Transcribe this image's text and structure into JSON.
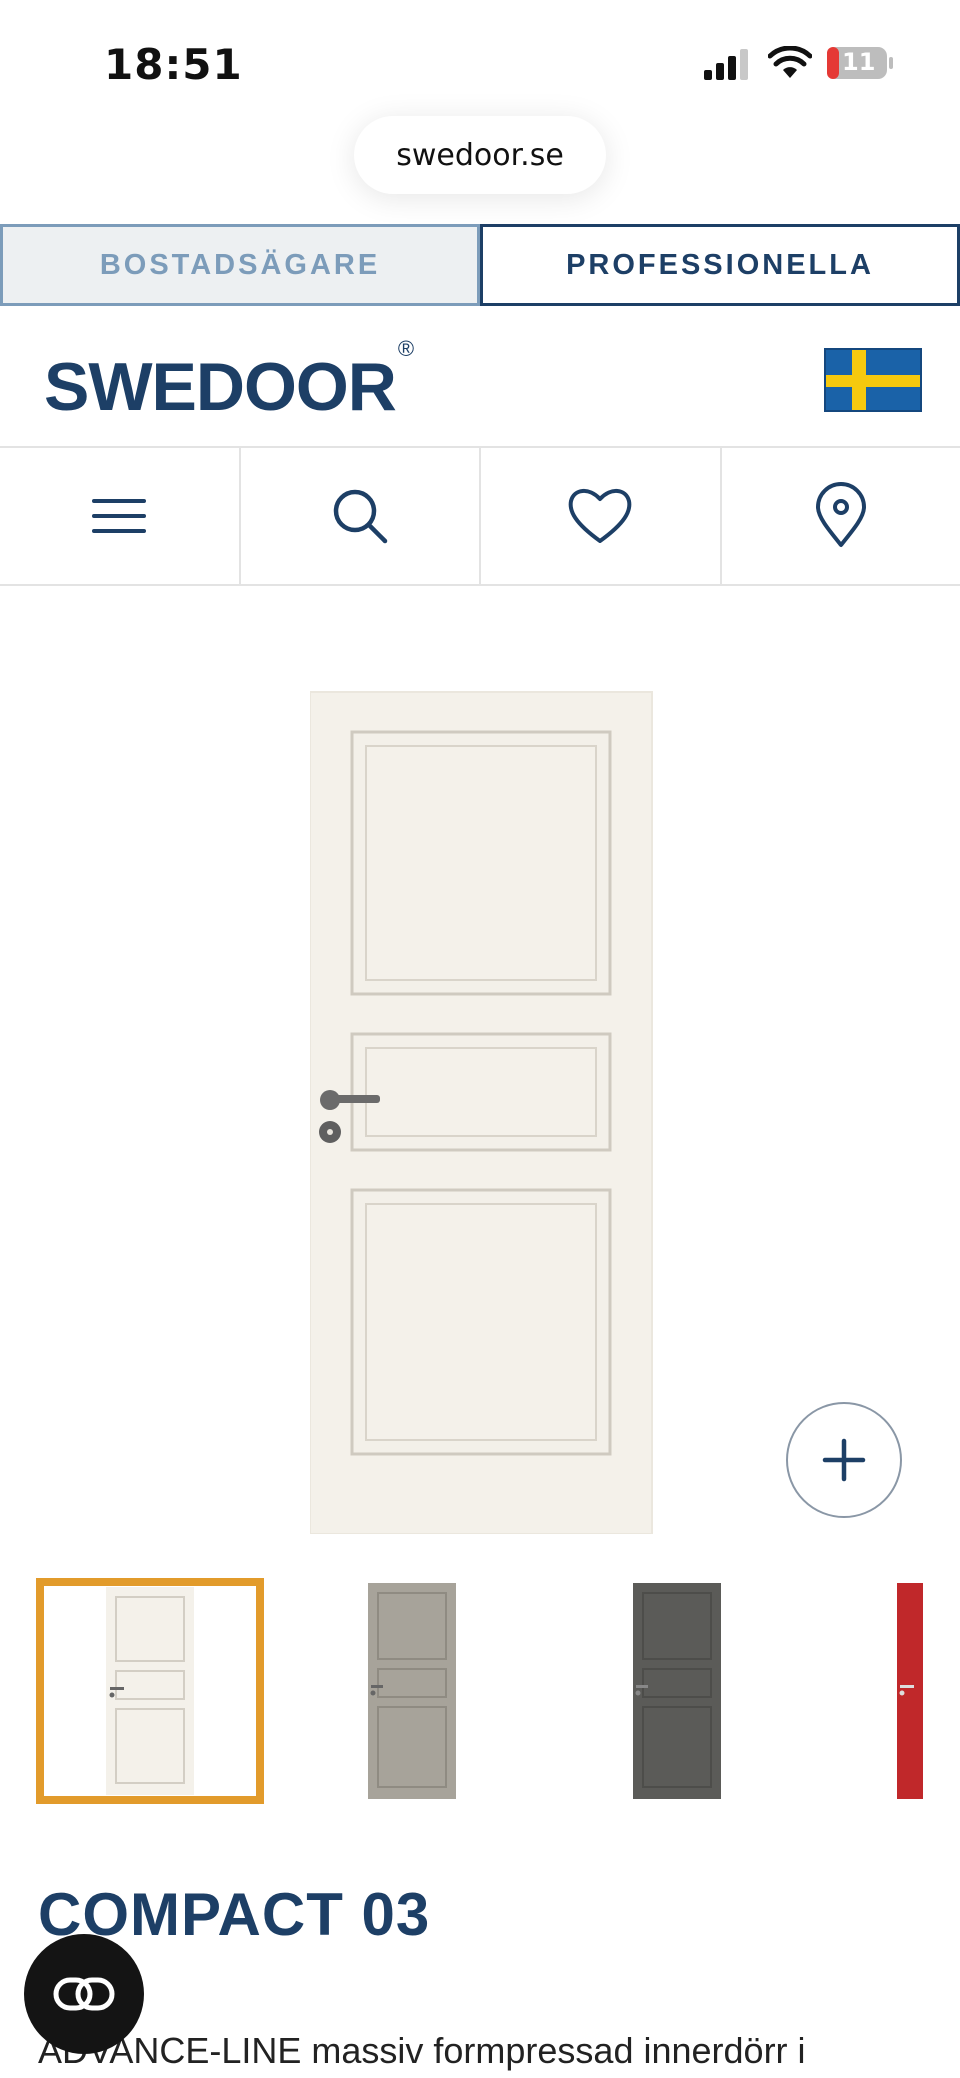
{
  "status": {
    "time": "18:51",
    "battery": "11"
  },
  "browser": {
    "url": "swedoor.se"
  },
  "audience_tabs": [
    {
      "label": "BOSTADSÄGARE"
    },
    {
      "label": "PROFESSIONELLA"
    }
  ],
  "header": {
    "logo": "SWEDOOR",
    "registered": "®",
    "country_flag": "sweden-flag"
  },
  "nav_icons": [
    "menu-icon",
    "search-icon",
    "heart-icon",
    "location-pin-icon"
  ],
  "product": {
    "title": "COMPACT 03",
    "description": "ADVANCE-LINE massiv formpressad innerdörr i",
    "variants": [
      {
        "color_name": "white",
        "color": "#f4f1ea",
        "selected": true
      },
      {
        "color_name": "grey-beige",
        "color": "#a7a39a",
        "selected": false
      },
      {
        "color_name": "dark-grey",
        "color": "#5b5b58",
        "selected": false
      },
      {
        "color_name": "red",
        "color": "#c0282a",
        "selected": false
      }
    ]
  },
  "colors": {
    "brand_blue": "#1d3f66",
    "selection_orange": "#e29b2b",
    "inactive_tab": "#7c9cba"
  }
}
